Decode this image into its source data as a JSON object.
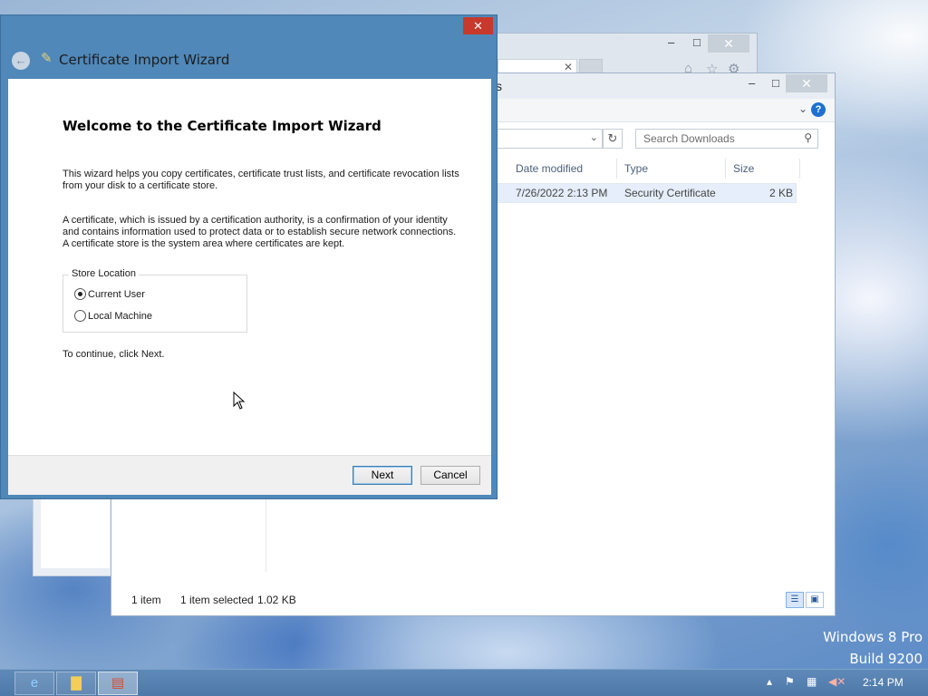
{
  "wizard": {
    "title": "Certificate Import Wizard",
    "heading": "Welcome to the Certificate Import Wizard",
    "intro": "This wizard helps you copy certificates, certificate trust lists, and certificate revocation lists from your disk to a certificate store.",
    "description": "A certificate, which is issued by a certification authority, is a confirmation of your identity and contains information used to protect data or to establish secure network connections. A certificate store is the system area where certificates are kept.",
    "store_location": {
      "legend": "Store Location",
      "options": [
        {
          "label": "Current User",
          "selected": true
        },
        {
          "label": "Local Machine",
          "selected": false
        }
      ]
    },
    "continue_text": "To continue, click Next.",
    "next_label": "Next",
    "cancel_label": "Cancel",
    "close_glyph": "✕"
  },
  "explorer": {
    "title_fragment": "s",
    "search_placeholder": "Search Downloads",
    "columns": [
      "Date modified",
      "Type",
      "Size"
    ],
    "file": {
      "date_modified": "7/26/2022 2:13 PM",
      "type": "Security Certificate",
      "size": "2 KB"
    },
    "status": {
      "item_count": "1 item",
      "selection": "1 item selected",
      "selection_size": "1.02 KB"
    }
  },
  "watermark": {
    "edition": "Windows 8 Pro",
    "build": "Build 9200"
  },
  "taskbar": {
    "clock": "2:14 PM",
    "apps": [
      {
        "icon": "internet-explorer-icon",
        "active": false
      },
      {
        "icon": "file-explorer-icon",
        "active": false
      },
      {
        "icon": "certificate-wizard-icon",
        "active": true
      }
    ]
  },
  "colors": {
    "wizard_frame": "#4f88b9",
    "close_button": "#c7392c",
    "selection": "#e5eefa",
    "taskbar": "#5480b0"
  }
}
